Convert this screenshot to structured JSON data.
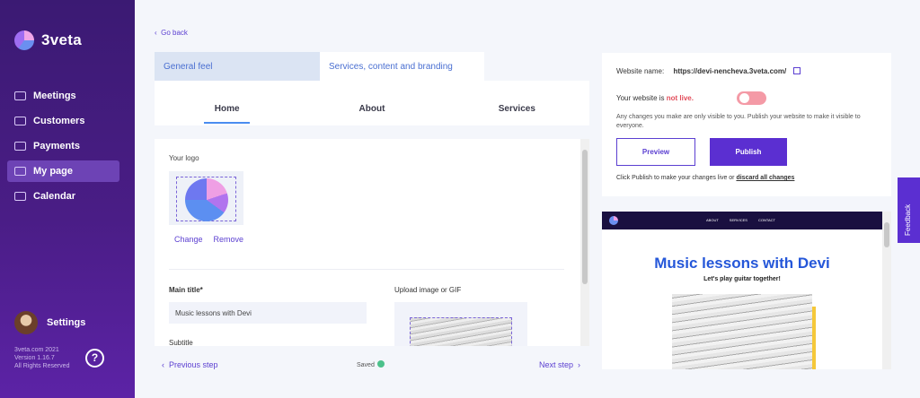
{
  "brand": {
    "name": "3veta"
  },
  "sidebar": {
    "items": [
      {
        "label": "Meetings",
        "icon": "meetings-icon"
      },
      {
        "label": "Customers",
        "icon": "customers-icon"
      },
      {
        "label": "Payments",
        "icon": "payments-icon"
      },
      {
        "label": "My page",
        "icon": "my-page-icon",
        "active": true
      },
      {
        "label": "Calendar",
        "icon": "calendar-icon"
      }
    ],
    "settings_label": "Settings",
    "footer": {
      "line1": "3veta.com 2021",
      "line2": "Version 1.16.7",
      "line3": "All Rights Reserved"
    },
    "help": "?"
  },
  "header": {
    "go_back": "Go back"
  },
  "tabs": [
    {
      "label": "General feel"
    },
    {
      "label": "Services, content and branding"
    }
  ],
  "subtabs": [
    {
      "label": "Home"
    },
    {
      "label": "About"
    },
    {
      "label": "Services"
    }
  ],
  "editor": {
    "logo_label": "Your logo",
    "change": "Change",
    "remove": "Remove",
    "main_title_label": "Main title*",
    "main_title_value": "Music lessons with Devi",
    "upload_label": "Upload image or GIF",
    "subtitle_label": "Subtitle"
  },
  "bottom_nav": {
    "prev": "Previous step",
    "saved": "Saved",
    "next": "Next step"
  },
  "website": {
    "name_label": "Website name:",
    "url": "https://devi-nencheva.3veta.com/",
    "live_prefix": "Your website is ",
    "live_status": "not live.",
    "note": "Any changes you make are only visible to you. Publish your website to make it visible to everyone.",
    "preview_button": "Preview",
    "publish_button": "Publish",
    "publish_note": "Click Publish to make your changes live or ",
    "discard_link": "discard all changes"
  },
  "preview": {
    "nav_links": [
      "ABOUT",
      "SERVICES",
      "CONTACT"
    ],
    "title": "Music lessons with Devi",
    "subtitle": "Let's play guitar together!"
  },
  "feedback": {
    "label": "Feedback"
  },
  "colors": {
    "accent": "#5b2fd1",
    "sidebar": "#4a1d86",
    "toggle_off": "#f49aa6",
    "title_blue": "#2557d9"
  }
}
